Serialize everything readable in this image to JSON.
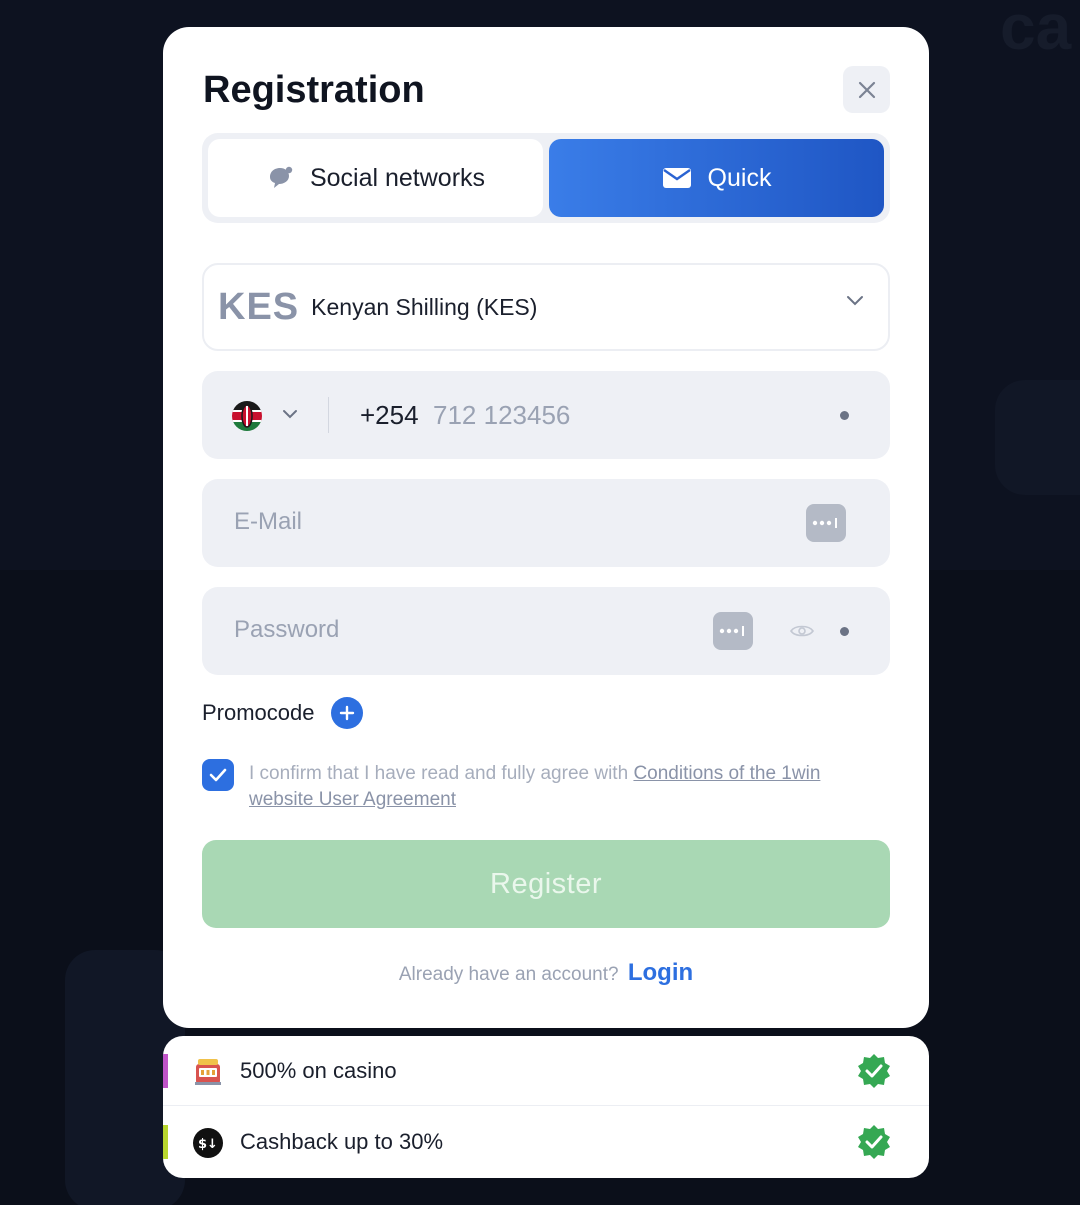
{
  "modal": {
    "title": "Registration",
    "close_icon": "close-icon"
  },
  "tabs": [
    {
      "label": "Social networks",
      "icon": "chat-bubble-icon",
      "active": false
    },
    {
      "label": "Quick",
      "icon": "envelope-icon",
      "active": true
    }
  ],
  "currency": {
    "code": "KES",
    "name": "Kenyan Shilling (KES)"
  },
  "phone": {
    "country_icon": "kenya-flag-icon",
    "code": "+254",
    "placeholder": "712 123456"
  },
  "email": {
    "placeholder": "E-Mail"
  },
  "password": {
    "placeholder": "Password"
  },
  "promo": {
    "label": "Promocode"
  },
  "agreement": {
    "checked": true,
    "text": "I confirm that I have read and fully agree with",
    "link": "Conditions of the 1win website User Agreement"
  },
  "register": {
    "label": "Register"
  },
  "account": {
    "prompt": "Already have an account?",
    "login": "Login"
  },
  "bonuses": [
    {
      "label": "500% on casino",
      "icon": "slot-machine-icon",
      "accent": "#c054c8"
    },
    {
      "label": "Cashback up to 30%",
      "icon": "cashback-icon",
      "accent": "#b8d62e"
    }
  ],
  "colors": {
    "primary": "#2d6fe0",
    "register_button": "#a9d8b4",
    "check_badge": "#35a853"
  }
}
